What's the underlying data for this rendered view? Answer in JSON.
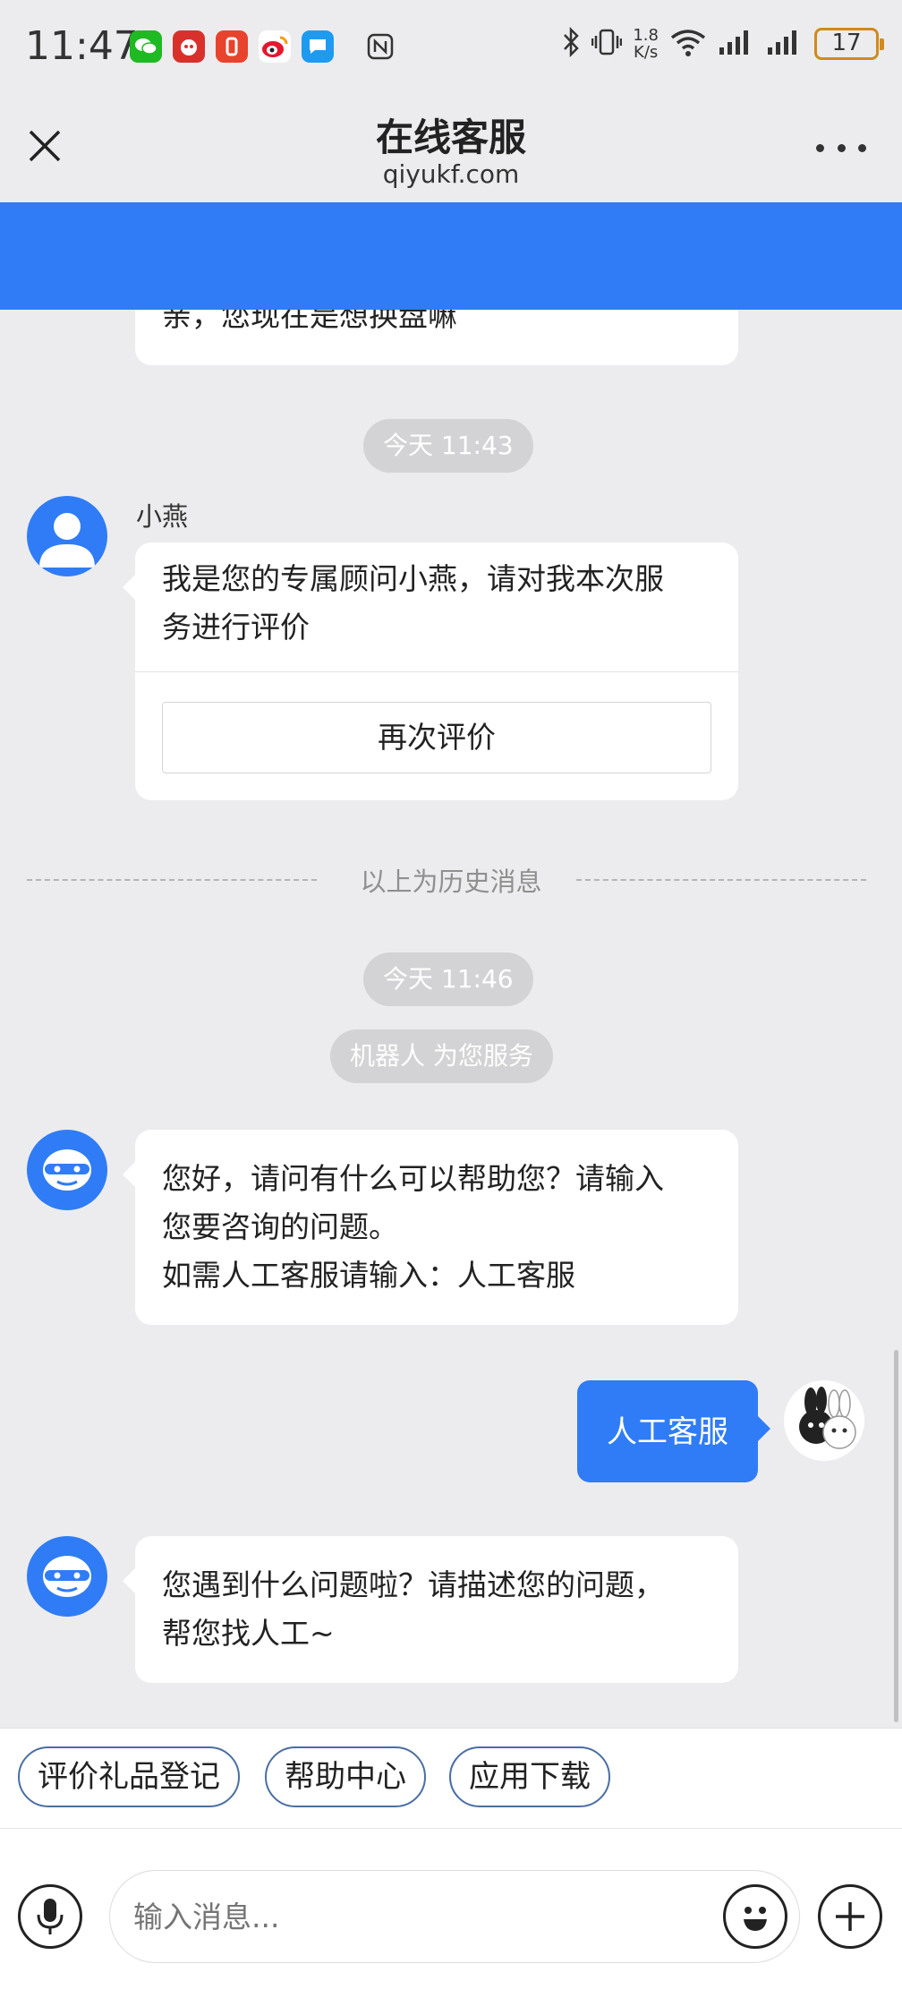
{
  "status_bar": {
    "time": "11:47",
    "net_speed_value": "1.8",
    "net_speed_unit": "K/s",
    "battery": "17",
    "app_icons": [
      "wechat-icon",
      "game-icon",
      "app-icon",
      "weibo-icon",
      "message-icon",
      "nfc-icon"
    ]
  },
  "header": {
    "title": "在线客服",
    "subtitle": "qiyukf.com"
  },
  "chat": {
    "clipped_message": "亲，您现在是想换盘嘛",
    "timestamp_1": "今天 11:43",
    "agent_name": "小燕",
    "agent_message_line1": "我是您的专属顾问小燕，请对我本次服",
    "agent_message_line2": "务进行评价",
    "rate_again_label": "再次评价",
    "history_divider": "以上为历史消息",
    "timestamp_2": "今天 11:46",
    "bot_notice": "机器人 为您服务",
    "bot_message1_line1": "您好，请问有什么可以帮助您？请输入",
    "bot_message1_line2": "您要咨询的问题。",
    "bot_message1_line3": "如需人工客服请输入：人工客服",
    "user_message": "人工客服",
    "bot_message2_line1": "您遇到什么问题啦？请描述您的问题，",
    "bot_message2_line2": "帮您找人工~"
  },
  "quick_replies": [
    "评价礼品登记",
    "帮助中心",
    "应用下载"
  ],
  "composer": {
    "placeholder": "输入消息..."
  },
  "colors": {
    "accent": "#2f7cf6",
    "background": "#ececee"
  }
}
